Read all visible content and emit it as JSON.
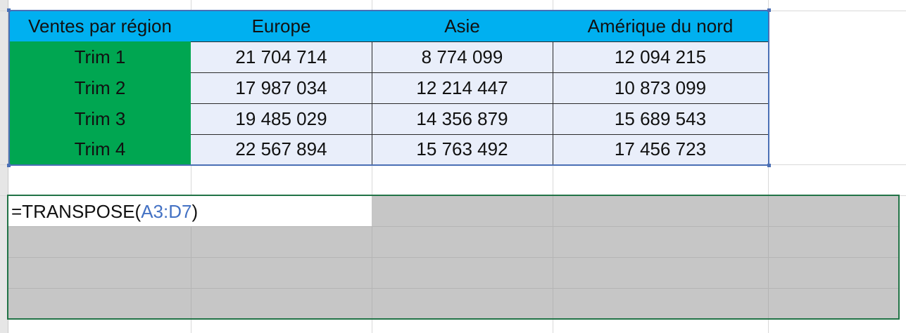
{
  "table": {
    "corner_label": "Ventes par région",
    "columns": [
      "Europe",
      "Asie",
      "Amérique du nord"
    ],
    "rows": [
      {
        "label": "Trim 1",
        "values": [
          "21 704 714",
          "8 774 099",
          "12 094 215"
        ]
      },
      {
        "label": "Trim 2",
        "values": [
          "17 987 034",
          "12 214 447",
          "10 873 099"
        ]
      },
      {
        "label": "Trim 3",
        "values": [
          "19 485 029",
          "14 356 879",
          "15 689 543"
        ]
      },
      {
        "label": "Trim 4",
        "values": [
          "22 567 894",
          "15 763 492",
          "17 456 723"
        ]
      }
    ]
  },
  "formula": {
    "prefix": "=TRANSPOSE(",
    "range_ref": "A3:D7",
    "suffix": ")"
  },
  "colors": {
    "header_bg": "#00b0f0",
    "row_label_bg": "#00a651",
    "value_bg": "#e9eefa",
    "range_ref": "#4472c4",
    "selection_fill": "#c6c6c6",
    "selection_border": "#217346",
    "table_border": "#4a6fb5"
  }
}
